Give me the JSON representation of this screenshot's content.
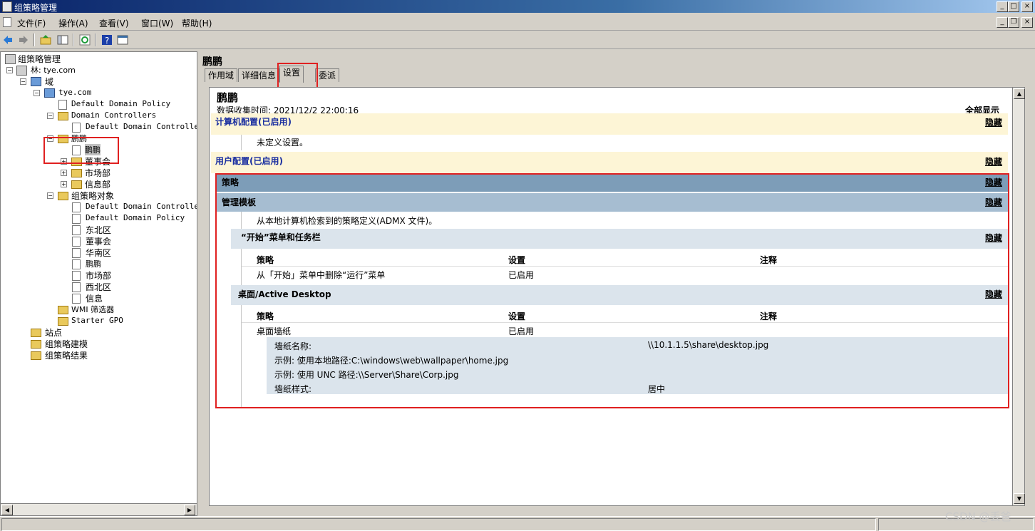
{
  "window": {
    "title": "组策略管理",
    "controls": {
      "minimize": "_",
      "maximize": "□",
      "close": "×",
      "child_minimize": "_",
      "child_restore": "❐",
      "child_close": "×"
    }
  },
  "menu": [
    "文件(F)",
    "操作(A)",
    "查看(V)",
    "窗口(W)",
    "帮助(H)"
  ],
  "toolbar": {
    "icons": [
      "back-icon",
      "forward-icon",
      "up-folder-icon",
      "show-pane-icon",
      "refresh-icon",
      "help-icon",
      "properties-icon"
    ]
  },
  "tree": [
    {
      "label": "组策略管理",
      "icon": "gpm-icon"
    },
    {
      "label": "林: tye.com",
      "icon": "forest-icon"
    },
    {
      "label": "域",
      "icon": "domains-icon"
    },
    {
      "label": "tye.com",
      "icon": "domain-icon"
    },
    {
      "label": "Default Domain Policy",
      "icon": "gpo-link-icon"
    },
    {
      "label": "Domain Controllers",
      "icon": "ou-icon"
    },
    {
      "label": "Default Domain Controllers",
      "icon": "gpo-link-icon"
    },
    {
      "label": "鹏鹏",
      "icon": "ou-icon"
    },
    {
      "label": "鹏鹏",
      "icon": "gpo-link-icon"
    },
    {
      "label": "董事会",
      "icon": "ou-icon"
    },
    {
      "label": "市场部",
      "icon": "ou-icon"
    },
    {
      "label": "信息部",
      "icon": "ou-icon"
    },
    {
      "label": "组策略对象",
      "icon": "gpo-container-icon"
    },
    {
      "label": "Default Domain Controllers",
      "icon": "gpo-icon"
    },
    {
      "label": "Default Domain Policy",
      "icon": "gpo-icon"
    },
    {
      "label": "东北区",
      "icon": "gpo-icon"
    },
    {
      "label": "董事会",
      "icon": "gpo-icon"
    },
    {
      "label": "华南区",
      "icon": "gpo-icon"
    },
    {
      "label": "鹏鹏",
      "icon": "gpo-icon"
    },
    {
      "label": "市场部",
      "icon": "gpo-icon"
    },
    {
      "label": "西北区",
      "icon": "gpo-icon"
    },
    {
      "label": "信息",
      "icon": "gpo-icon"
    },
    {
      "label": "WMI 筛选器",
      "icon": "wmi-folder-icon"
    },
    {
      "label": "Starter GPO",
      "icon": "starter-gpo-icon"
    },
    {
      "label": "站点",
      "icon": "sites-icon"
    },
    {
      "label": "组策略建模",
      "icon": "modeling-icon"
    },
    {
      "label": "组策略结果",
      "icon": "results-icon"
    }
  ],
  "right": {
    "gpo_title": "鹏鹏",
    "tabs": [
      "作用域",
      "详细信息",
      "设置",
      "委派"
    ],
    "active_tab": "设置",
    "report": {
      "name": "鹏鹏",
      "collected": "数据收集时间: 2021/12/2 22:00:16",
      "show_all": "全部显示",
      "computer_config": "计算机配置(已启用)",
      "hide": "隐藏",
      "no_settings": "未定义设置。",
      "user_config": "用户配置(已启用)",
      "policies": "策略",
      "admin_templates": "管理模板",
      "admx_note": "从本地计算机检索到的策略定义(ADMX 文件)。",
      "start_menu_title": "“开始”菜单和任务栏",
      "col_policy": "策略",
      "col_setting": "设置",
      "col_comment": "注释",
      "row1_policy": "从「开始」菜单中删除“运行”菜单",
      "row1_setting": "已启用",
      "desktop_title": "桌面/Active Desktop",
      "row2_policy": "桌面墙纸",
      "row2_setting": "已启用",
      "wp_name_label": "墙纸名称:",
      "wp_name_value": "\\\\10.1.1.5\\share\\desktop.jpg",
      "wp_example1": "示例: 使用本地路径:C:\\windows\\web\\wallpaper\\home.jpg",
      "wp_example2": "示例: 使用 UNC 路径:\\\\Server\\Share\\Corp.jpg",
      "wp_style_label": "墙纸样式:",
      "wp_style_value": "居中"
    }
  },
  "watermark": "CSDN @丢爸"
}
